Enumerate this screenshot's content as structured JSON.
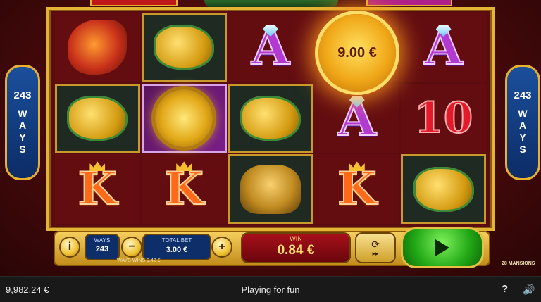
{
  "side_badges": {
    "number": "243",
    "word": "WAYS"
  },
  "reels": [
    [
      "phoenix",
      "golden-toad",
      "a",
      "coin-wild",
      "a"
    ],
    [
      "golden-toad",
      "medallion-wild",
      "golden-toad",
      "a",
      "ten"
    ],
    [
      "k",
      "k",
      "tiger",
      "k",
      "golden-toad"
    ]
  ],
  "coin": {
    "value": "9.00 €"
  },
  "controls": {
    "info": "i",
    "ways_label": "WAYS",
    "ways_value": "243",
    "minus": "−",
    "plus": "+",
    "bet_label": "TOTAL BET",
    "bet_value": "3.00 €",
    "win_label": "WIN",
    "win_value": "0.84 €",
    "autoplay_icon": "⟳",
    "fast_icon": "▸▸",
    "ticker": "WAYS  WINS  0.42  €",
    "logo": "28  MANSIONS"
  },
  "status": {
    "balance": "9,982.24 €",
    "mode": "Playing for fun",
    "help": "?",
    "sound": "🔊"
  },
  "colors": {
    "frame": "#e4b436",
    "spin": "#22a816",
    "badge": "#1b4f9c"
  }
}
